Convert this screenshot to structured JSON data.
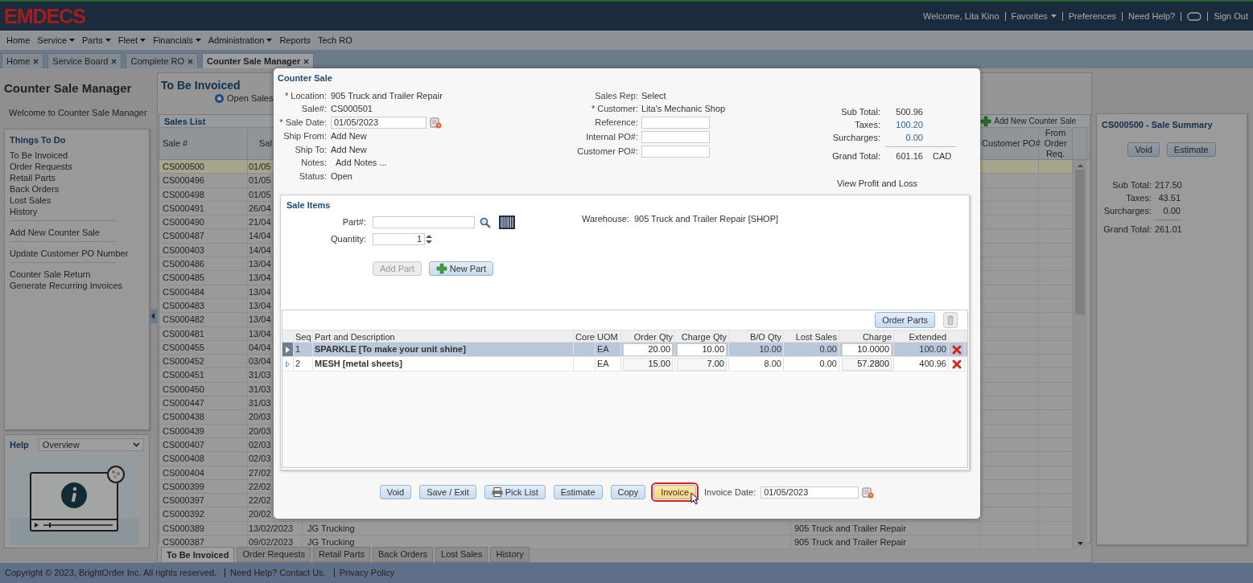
{
  "header": {
    "logo": "EMDECS",
    "links": [
      {
        "kind": "text",
        "text": "Welcome, Lita Kino"
      },
      {
        "kind": "menu",
        "text": "Favorites"
      },
      {
        "kind": "link",
        "text": "Preferences"
      },
      {
        "kind": "link",
        "text": "Need Help?"
      },
      {
        "kind": "chat"
      },
      {
        "kind": "link",
        "text": "Sign Out"
      }
    ]
  },
  "menu": [
    {
      "label": "Home",
      "has_menu": false
    },
    {
      "label": "Service",
      "has_menu": true
    },
    {
      "label": "Parts",
      "has_menu": true
    },
    {
      "label": "Fleet",
      "has_menu": true
    },
    {
      "label": "Financials",
      "has_menu": true
    },
    {
      "label": "Administration",
      "has_menu": true
    },
    {
      "label": "Reports",
      "has_menu": false
    },
    {
      "label": "Tech RO",
      "has_menu": false
    }
  ],
  "tabs": [
    {
      "label": "Home",
      "selected": false
    },
    {
      "label": "Service Board",
      "selected": false
    },
    {
      "label": "Complete RO",
      "selected": false
    },
    {
      "label": "Counter Sale Manager",
      "selected": true
    }
  ],
  "left": {
    "title": "Counter Sale Manager",
    "welcome": "Welcome to Counter Sale Manager",
    "todo": {
      "title": "Things To Do",
      "groups": [
        [
          "To Be Invoiced",
          "Order Requests",
          "Retail Parts",
          "Back Orders",
          "Lost Sales",
          "History"
        ],
        [
          "Add New Counter Sale"
        ],
        [
          "Update Customer PO Number"
        ],
        [
          "Counter Sale Return",
          "Generate Recurring Invoices"
        ]
      ]
    },
    "help": {
      "title": "Help",
      "topic": "Overview"
    }
  },
  "list_view": {
    "title": "To Be Invoiced",
    "filter": {
      "label": "Open Sales",
      "selected": true
    },
    "sales_list": {
      "title": "Sales List",
      "add_button": "Add New Counter Sale",
      "columns": {
        "sale_no": "Sale #",
        "date": "Sal",
        "customer_po": "Customer PO#",
        "from_order_req": "From Order Req."
      },
      "rows": [
        {
          "sale_no": "CS000500",
          "date": "01/05",
          "selected": true
        },
        {
          "sale_no": "CS000496",
          "date": "01/05",
          "selected": false
        },
        {
          "sale_no": "CS000498",
          "date": "01/05",
          "selected": false
        },
        {
          "sale_no": "CS000491",
          "date": "26/04",
          "selected": false
        },
        {
          "sale_no": "CS000490",
          "date": "21/04",
          "selected": false
        },
        {
          "sale_no": "CS000487",
          "date": "14/04",
          "selected": false
        },
        {
          "sale_no": "CS000403",
          "date": "14/04",
          "selected": false
        },
        {
          "sale_no": "CS000486",
          "date": "13/04",
          "selected": false
        },
        {
          "sale_no": "CS000485",
          "date": "13/04",
          "selected": false
        },
        {
          "sale_no": "CS000484",
          "date": "13/04",
          "selected": false
        },
        {
          "sale_no": "CS000483",
          "date": "13/04",
          "selected": false
        },
        {
          "sale_no": "CS000482",
          "date": "13/04",
          "selected": false
        },
        {
          "sale_no": "CS000481",
          "date": "13/04",
          "selected": false
        },
        {
          "sale_no": "CS000455",
          "date": "04/04",
          "selected": false
        },
        {
          "sale_no": "CS000452",
          "date": "03/04",
          "selected": false
        },
        {
          "sale_no": "CS000451",
          "date": "31/03",
          "selected": false
        },
        {
          "sale_no": "CS000450",
          "date": "31/03",
          "selected": false
        },
        {
          "sale_no": "CS000447",
          "date": "31/03",
          "selected": false
        },
        {
          "sale_no": "CS000438",
          "date": "20/03",
          "selected": false
        },
        {
          "sale_no": "CS000439",
          "date": "20/03",
          "selected": false
        },
        {
          "sale_no": "CS000407",
          "date": "02/03",
          "selected": false
        },
        {
          "sale_no": "CS000408",
          "date": "02/03",
          "selected": false
        },
        {
          "sale_no": "CS000404",
          "date": "27/02",
          "selected": false
        },
        {
          "sale_no": "CS000399",
          "date": "22/02",
          "selected": false
        },
        {
          "sale_no": "CS000397",
          "date": "22/02",
          "selected": false
        },
        {
          "sale_no": "CS000392",
          "date": "20/02",
          "selected": false
        },
        {
          "sale_no": "CS000389",
          "date": "13/02/2023",
          "customer": "JG Trucking",
          "location": "905 Truck and Trailer Repair",
          "selected": false
        },
        {
          "sale_no": "CS000387",
          "date": "09/02/2023",
          "customer": "JG Trucking",
          "location": "905 Truck and Trailer Repair",
          "selected": false
        }
      ]
    },
    "bottom_tabs": [
      {
        "label": "To Be Invoiced",
        "selected": true
      },
      {
        "label": "Order Requests",
        "selected": false
      },
      {
        "label": "Retail Parts",
        "selected": false
      },
      {
        "label": "Back Orders",
        "selected": false
      },
      {
        "label": "Lost Sales",
        "selected": false
      },
      {
        "label": "History",
        "selected": false
      }
    ]
  },
  "summary": {
    "title": "CS000500 - Sale Summary",
    "buttons": [
      "Void",
      "Estimate"
    ],
    "totals": [
      {
        "label": "Sub Total:",
        "kind": "text",
        "value": "217.50"
      },
      {
        "label": "Taxes:",
        "kind": "text",
        "value": "43.51"
      },
      {
        "label": "Surcharges:",
        "kind": "text",
        "value": "0.00"
      },
      {
        "label": "Grand Total:",
        "kind": "total",
        "value": "261.01"
      }
    ]
  },
  "footer": {
    "copyright": "Copyright © 2023, BrightOrder Inc. All rights reserved.",
    "links": [
      "Need Help? Contact Us.",
      "Privacy Policy"
    ]
  },
  "dialog": {
    "title": "Counter Sale",
    "left_fields": [
      {
        "label": "* Location:",
        "kind": "link",
        "value": "905 Truck and Trailer Repair"
      },
      {
        "label": "Sale#:",
        "kind": "text",
        "value": "CS000501"
      },
      {
        "label": "* Sale Date:",
        "kind": "date",
        "value": "01/05/2023"
      },
      {
        "label": "Ship From:",
        "kind": "link",
        "value": "Add New"
      },
      {
        "label": "Ship To:",
        "kind": "link",
        "value": "Add New"
      },
      {
        "label": "Notes:",
        "kind": "link",
        "value": "Add Notes ..."
      },
      {
        "label": "Status:",
        "kind": "text",
        "value": "Open"
      }
    ],
    "middle_fields": [
      {
        "label": "Sales Rep:",
        "kind": "link",
        "value": "Select"
      },
      {
        "label": "* Customer:",
        "kind": "link",
        "value": "Lita's Mechanic Shop"
      },
      {
        "label": "Reference:",
        "kind": "input"
      },
      {
        "label": "Internal PO#:",
        "kind": "input"
      },
      {
        "label": "Customer PO#:",
        "kind": "input"
      }
    ],
    "totals": [
      {
        "label": "Sub Total:",
        "kind": "text",
        "value": "500.96"
      },
      {
        "label": "Taxes:",
        "kind": "link",
        "value": "100.20"
      },
      {
        "label": "Surcharges:",
        "kind": "link",
        "value": "0.00"
      },
      {
        "label": "Grand Total:",
        "kind": "total",
        "value": "601.16",
        "currency": "CAD"
      }
    ],
    "profit_link": "View Profit and Loss",
    "sale_items": {
      "title": "Sale Items",
      "part_label": "Part#:",
      "quantity_label": "Quantity:",
      "quantity": "1",
      "warehouse_label": "Warehouse:",
      "warehouse": "905 Truck and Trailer Repair [SHOP]",
      "add_part": {
        "label": "Add Part",
        "disabled": true
      },
      "new_part": "New Part",
      "order_parts": "Order Parts",
      "columns": [
        "Seq",
        "Part and Description",
        "Core",
        "UOM",
        "Order Qty",
        "Charge Qty",
        "B/O Qty",
        "Lost Sales",
        "Charge",
        "Extended"
      ],
      "rows": [
        {
          "seq": "1",
          "part": "SPARKLE [To make your unit shine]",
          "uom": "EA",
          "order_qty": "20.00",
          "charge_qty": "10.00",
          "bo_qty": "10.00",
          "lost_sales": "0.00",
          "charge": "10.0000",
          "extended": "100.00",
          "selected": true
        },
        {
          "seq": "2",
          "part": "MESH [metal sheets]",
          "uom": "EA",
          "order_qty": "15.00",
          "charge_qty": "7.00",
          "bo_qty": "8.00",
          "lost_sales": "0.00",
          "charge": "57.2800",
          "extended": "400.96",
          "selected": false
        }
      ]
    },
    "buttons": [
      {
        "label": "Void",
        "kind": "plain",
        "highlighted": false
      },
      {
        "label": "Save / Exit",
        "kind": "plain",
        "highlighted": false
      },
      {
        "label": "Pick List",
        "kind": "print",
        "highlighted": false
      },
      {
        "label": "Estimate",
        "kind": "plain",
        "highlighted": false
      },
      {
        "label": "Copy",
        "kind": "plain",
        "highlighted": false
      },
      {
        "label": "Invoice",
        "kind": "plain",
        "highlighted": true
      }
    ],
    "invoice_date_label": "Invoice Date:",
    "invoice_date": "01/05/2023"
  }
}
